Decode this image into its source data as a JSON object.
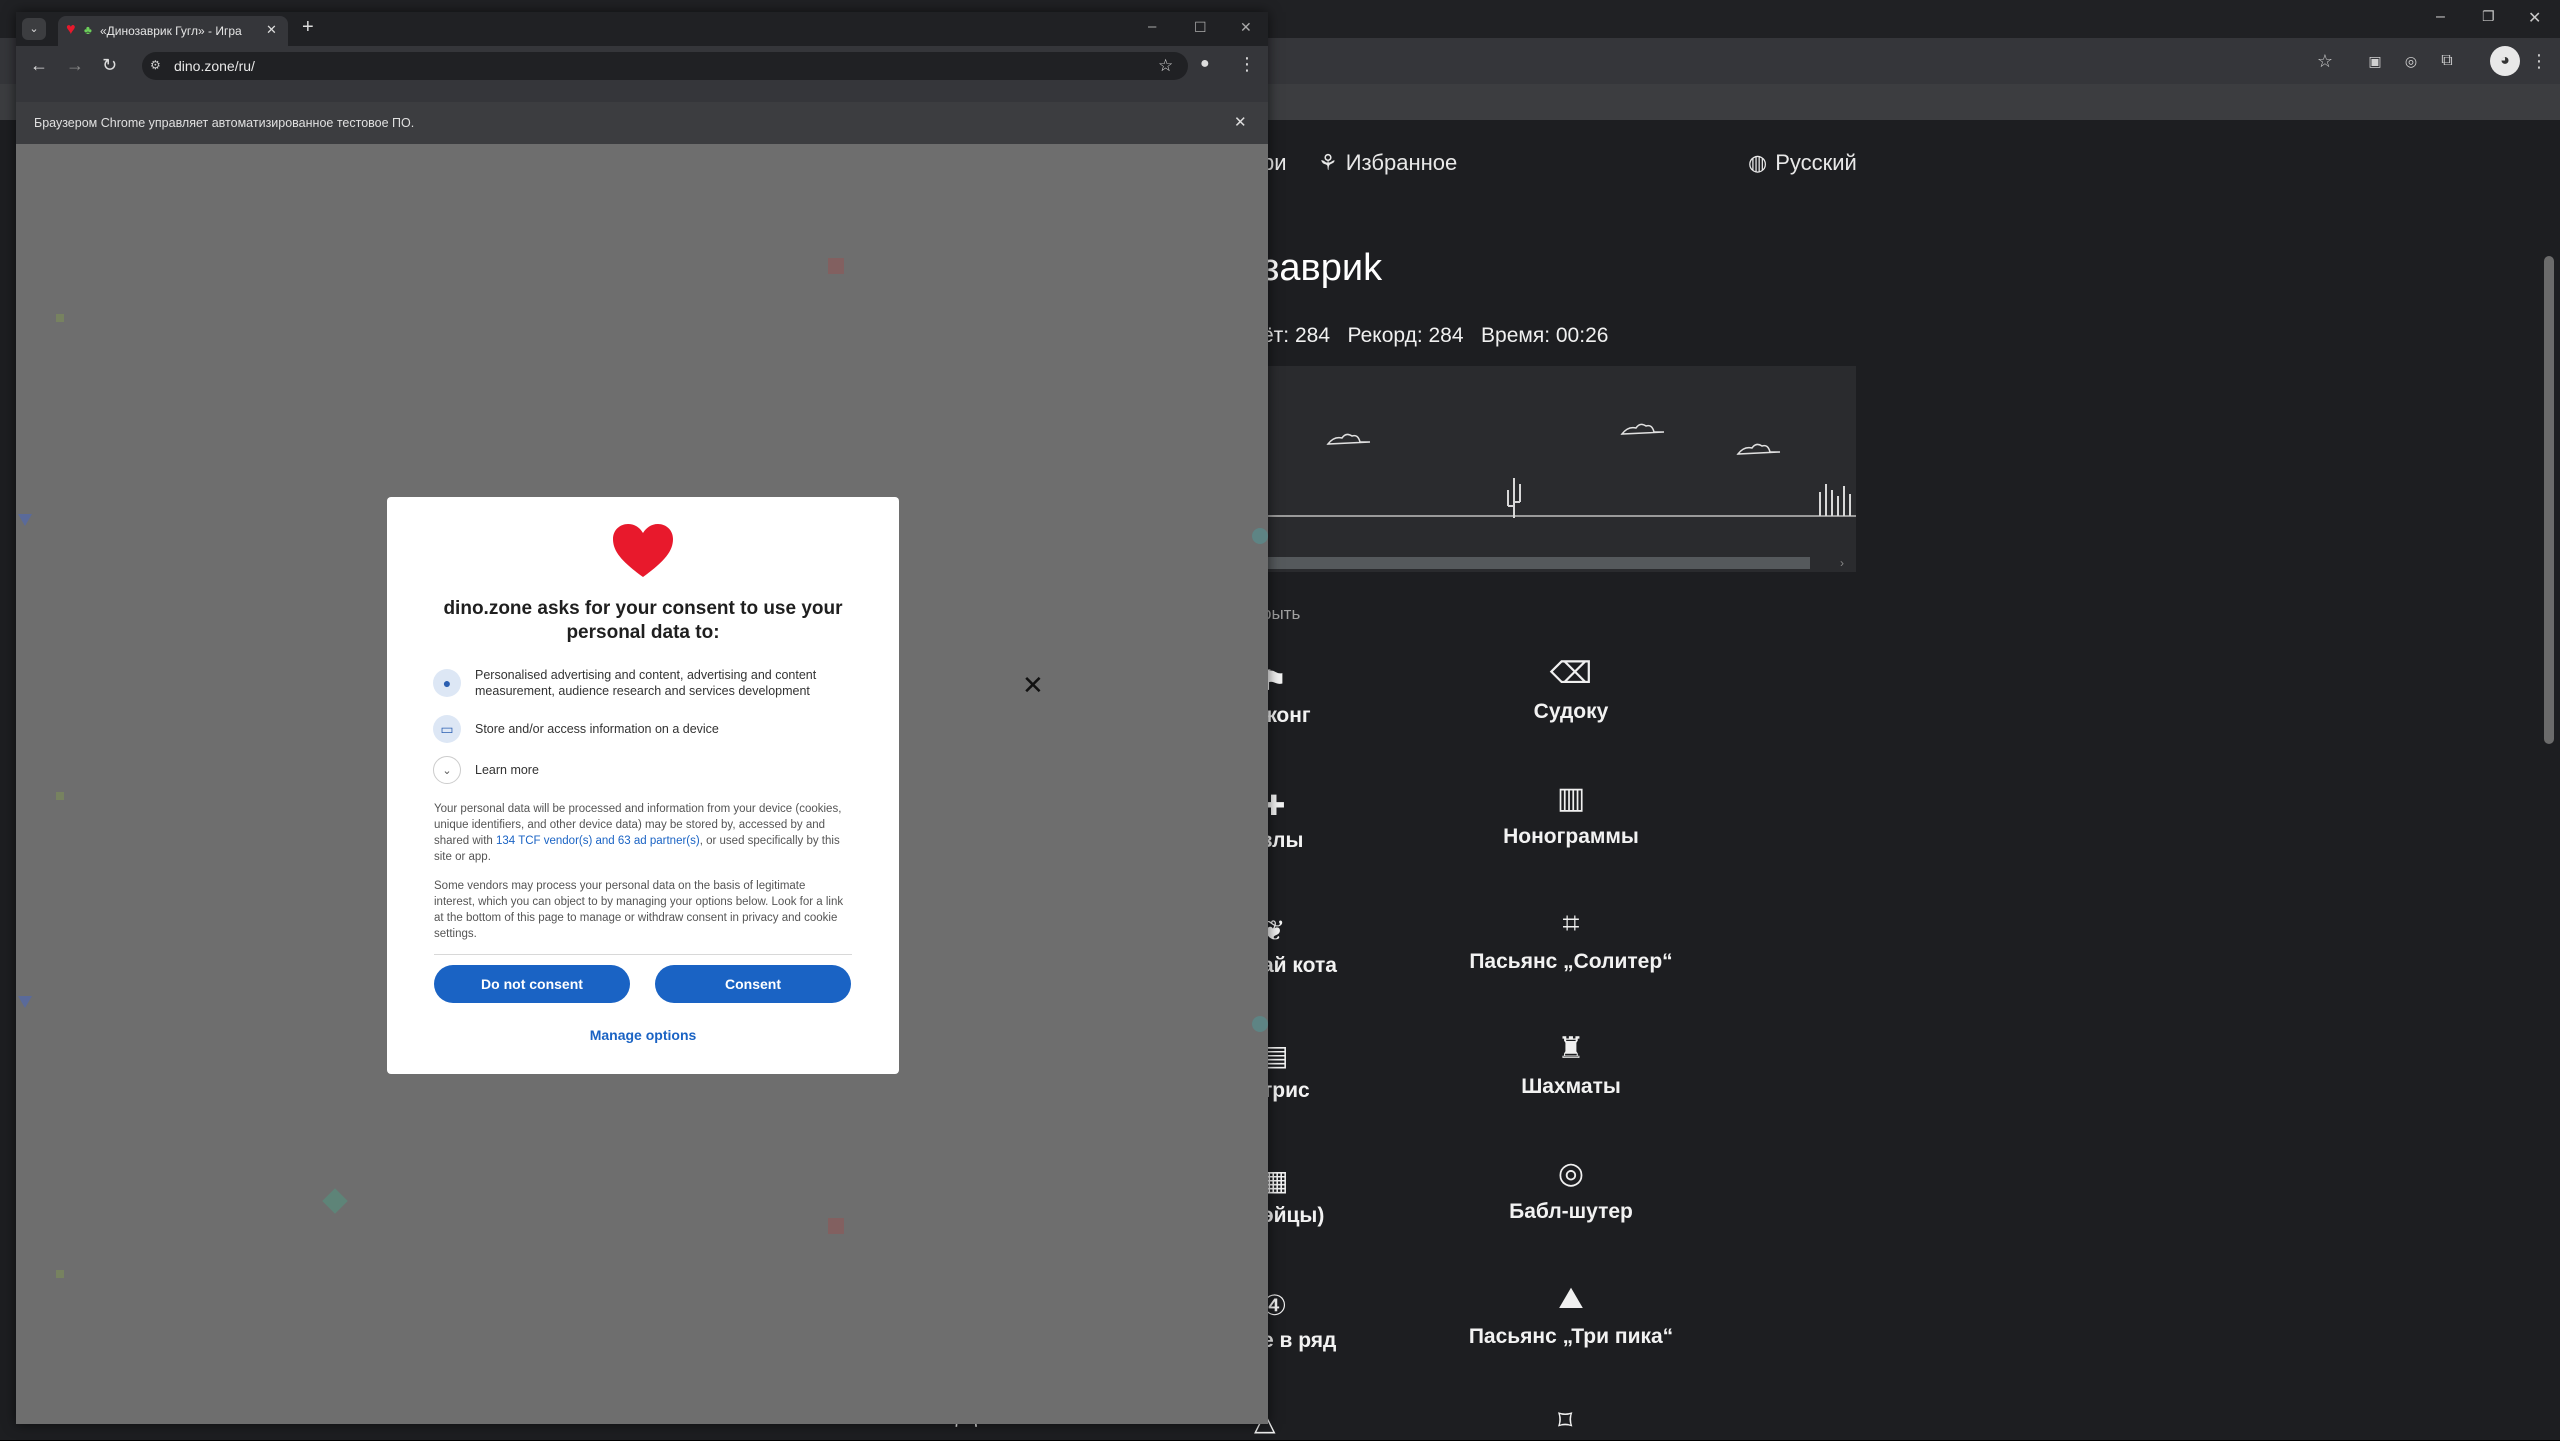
{
  "background_browser": {
    "nav_left_fragment": "ри",
    "nav_favorites": "Избранное",
    "nav_language": "Русский",
    "heading_fragment": "завриk",
    "stats": "ёт: 284   Рекорд: 284   Время: 00:26",
    "hide_link_fragment": "рыть",
    "tiles_right": [
      "Судоку",
      "Нонограммы",
      "Пасьянс „Солитер“",
      "Шахматы",
      "Бабл-шутер",
      "Пасьянс „Три пика“"
    ],
    "tiles_left": [
      "жонг",
      "злы",
      "ай кота",
      "трис",
      "эйцы)",
      "е в ряд"
    ],
    "window_controls": [
      "–",
      "❐",
      "✕"
    ]
  },
  "front_window": {
    "tab_title": "«Динозаврик Гугл» - Игра",
    "new_tab": "+",
    "url": "dino.zone/ru/",
    "infobar_text": "Браузером Chrome управляет автоматизированное тестовое ПО.",
    "window_controls": [
      "–",
      "☐",
      "✕"
    ]
  },
  "dialog": {
    "title": "dino.zone asks for your consent to use your personal data to:",
    "purposes": [
      "Personalised advertising and content, advertising and content measurement, audience research and services development",
      "Store and/or access information on a device"
    ],
    "learn_more": "Learn more",
    "para1_before": "Your personal data will be processed and information from your device (cookies, unique identifiers, and other device data) may be stored by, accessed by and shared with ",
    "para1_link": "134 TCF vendor(s) and 63 ad partner(s)",
    "para1_after": ", or used specifically by this site or app.",
    "para2": "Some vendors may process your personal data on the basis of legitimate interest, which you can object to by managing your options below. Look for a link at the bottom of this page to manage or withdraw consent in privacy and cookie settings.",
    "do_not_consent": "Do not consent",
    "consent": "Consent",
    "manage_options": "Manage options"
  },
  "colors": {
    "dialog_accent": "#1a63c4",
    "heart": "#e8192c"
  }
}
